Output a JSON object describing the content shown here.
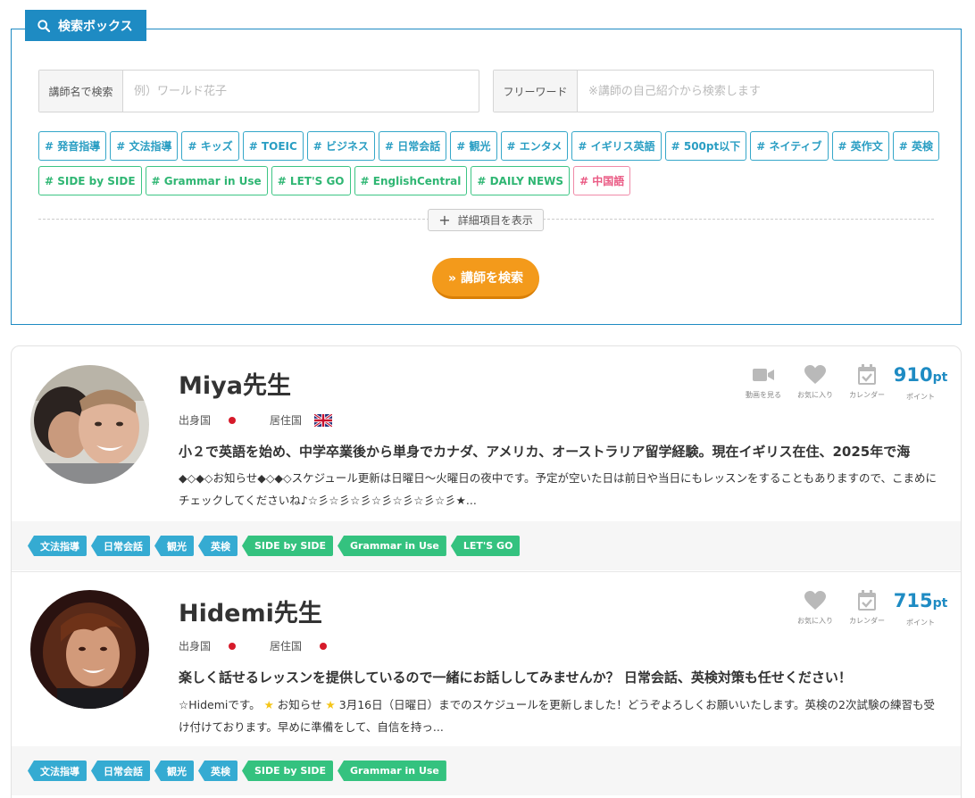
{
  "search": {
    "title": "検索ボックス",
    "name_label": "講師名で検索",
    "name_placeholder": "例）ワールド花子",
    "free_label": "フリーワード",
    "free_placeholder": "※講師の自己紹介から検索します",
    "tags_row1": [
      "# 発音指導",
      "# 文法指導",
      "# キッズ",
      "# TOEIC",
      "# ビジネス",
      "# 日常会話",
      "# 観光",
      "# エンタメ",
      "# イギリス英語",
      "# 500pt以下",
      "# ネイティブ",
      "# 英作文",
      "# 英検"
    ],
    "tags_row2": [
      {
        "label": "# SIDE by SIDE",
        "color": "green"
      },
      {
        "label": "# Grammar in Use",
        "color": "green"
      },
      {
        "label": "# LET'S GO",
        "color": "green"
      },
      {
        "label": "# EnglishCentral",
        "color": "green"
      },
      {
        "label": "# DAILY NEWS",
        "color": "green"
      },
      {
        "label": "# 中国語",
        "color": "pink"
      }
    ],
    "detail_toggle": "詳細項目を表示",
    "submit_label": "» 講師を検索"
  },
  "labels": {
    "origin": "出身国",
    "residence": "居住国",
    "video": "動画を見る",
    "favorite": "お気に入り",
    "calendar": "カレンダー",
    "points": "ポイント",
    "pt_unit": "pt"
  },
  "teachers": [
    {
      "name": "Miya先生",
      "origin_flag": "japan-flag",
      "residence_flag": "uk-flag",
      "has_video": true,
      "points": "910",
      "catchphrase": "小２で英語を始め、中学卒業後から単身でカナダ、アメリカ、オーストラリア留学経験。現在イギリス在住、2025年で海",
      "intro": "◆◇◆◇お知らせ◆◇◆◇スケジュール更新は日曜日〜火曜日の夜中です。予定が空いた日は前日や当日にもレッスンをすることもありますので、こまめにチェックしてくださいね♪☆彡☆彡☆彡☆彡☆彡☆彡☆彡★...",
      "tags": [
        {
          "label": "文法指導",
          "color": "blue"
        },
        {
          "label": "日常会話",
          "color": "blue"
        },
        {
          "label": "観光",
          "color": "blue"
        },
        {
          "label": "英検",
          "color": "blue"
        },
        {
          "label": "SIDE by SIDE",
          "color": "green"
        },
        {
          "label": "Grammar in Use",
          "color": "green"
        },
        {
          "label": "LET'S GO",
          "color": "green"
        }
      ]
    },
    {
      "name": "Hidemi先生",
      "origin_flag": "japan-flag",
      "residence_flag": "japan-flag",
      "has_video": false,
      "points": "715",
      "catchphrase": "楽しく話せるレッスンを提供しているので一緒にお話ししてみませんか？ 日常会話、英検対策も任せください！",
      "intro_pre": "☆Hidemiです。",
      "intro_notice": "お知らせ",
      "intro_post": "3月16日（日曜日）までのスケジュールを更新しました！どうぞよろしくお願いいたします。英検の2次試験の練習も受け付けております。早めに準備をして、自信を持っ...",
      "tags": [
        {
          "label": "文法指導",
          "color": "blue"
        },
        {
          "label": "日常会話",
          "color": "blue"
        },
        {
          "label": "観光",
          "color": "blue"
        },
        {
          "label": "英検",
          "color": "blue"
        },
        {
          "label": "SIDE by SIDE",
          "color": "green"
        },
        {
          "label": "Grammar in Use",
          "color": "green"
        }
      ]
    }
  ],
  "colors": {
    "brand_blue": "#1e8bc3",
    "tag_green": "#34c27f",
    "tag_pink": "#ea5a84",
    "search_orange": "#f39a1b"
  }
}
